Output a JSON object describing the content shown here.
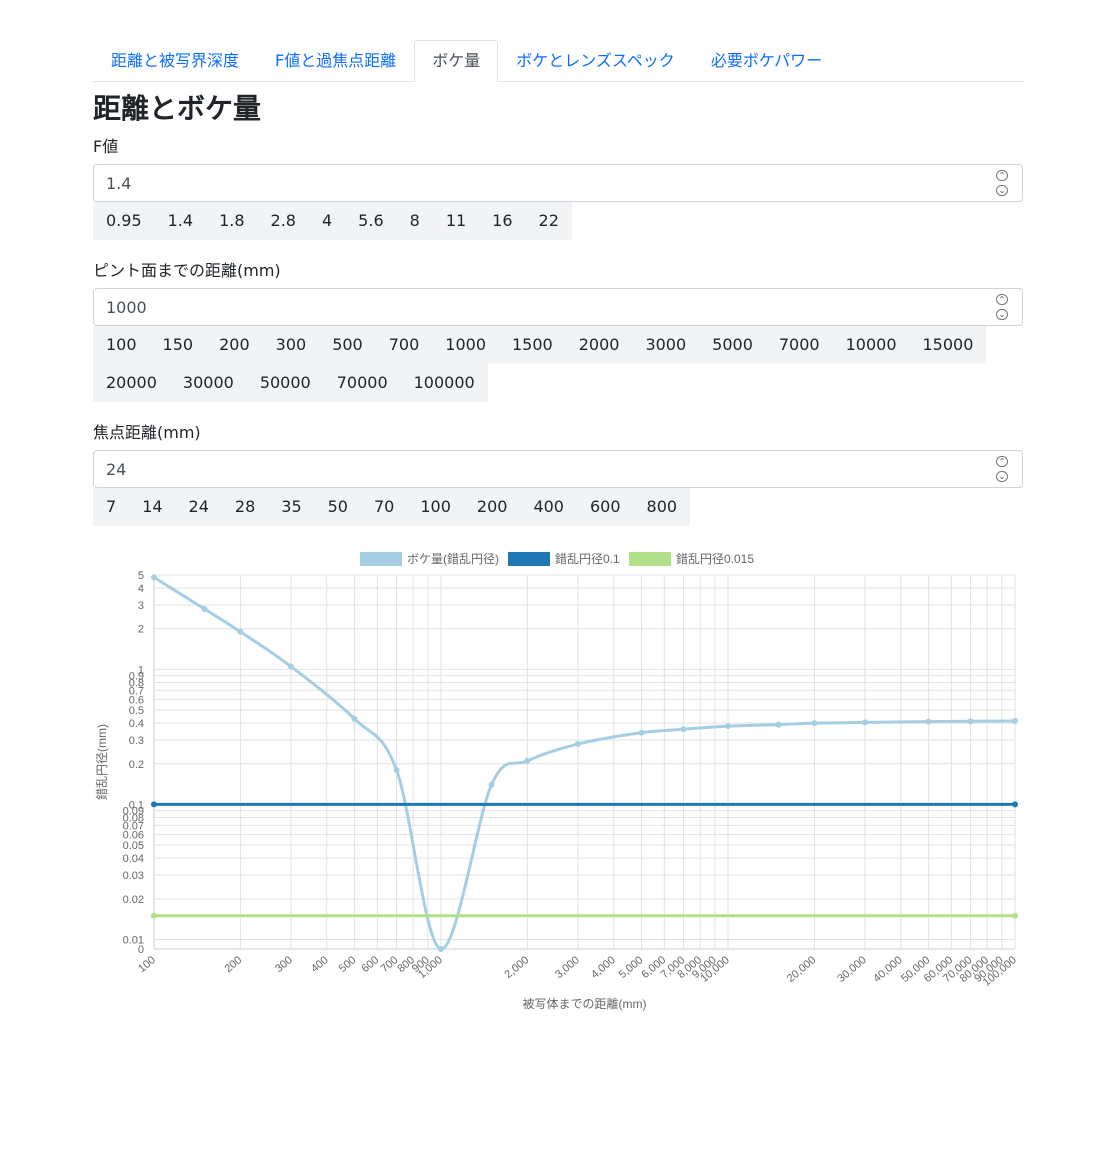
{
  "tabs": [
    {
      "label": "距離と被写界深度",
      "active": false
    },
    {
      "label": "F値と過焦点距離",
      "active": false
    },
    {
      "label": "ボケ量",
      "active": true
    },
    {
      "label": "ボケとレンズスペック",
      "active": false
    },
    {
      "label": "必要ボケパワー",
      "active": false
    }
  ],
  "page_title": "距離とボケ量",
  "fnumber": {
    "label": "F値",
    "value": "1.4",
    "presets": [
      "0.95",
      "1.4",
      "1.8",
      "2.8",
      "4",
      "5.6",
      "8",
      "11",
      "16",
      "22"
    ]
  },
  "distance": {
    "label": "ピント面までの距離(mm)",
    "value": "1000",
    "presets": [
      "100",
      "150",
      "200",
      "300",
      "500",
      "700",
      "1000",
      "1500",
      "2000",
      "3000",
      "5000",
      "7000",
      "10000",
      "15000",
      "20000",
      "30000",
      "50000",
      "70000",
      "100000"
    ]
  },
  "focal": {
    "label": "焦点距離(mm)",
    "value": "24",
    "presets": [
      "7",
      "14",
      "24",
      "28",
      "35",
      "50",
      "70",
      "100",
      "200",
      "400",
      "600",
      "800"
    ]
  },
  "chart_data": {
    "type": "line",
    "xlabel": "被写体までの距離(mm)",
    "ylabel": "錯乱円径(mm)",
    "x_scale": "log",
    "y_scale": "log",
    "xlim": [
      100,
      100000
    ],
    "ylim": [
      0,
      5
    ],
    "x_ticks": [
      "100",
      "200",
      "300",
      "400",
      "500",
      "600",
      "700",
      "800",
      "900",
      "1,000",
      "2,000",
      "3,000",
      "4,000",
      "5,000",
      "6,000",
      "7,000",
      "8,000",
      "9,000",
      "10,000",
      "20,000",
      "30,000",
      "40,000",
      "50,000",
      "60,000",
      "70,000",
      "80,000",
      "90,000",
      "100,000"
    ],
    "y_ticks": [
      "0",
      "0.01",
      "0.02",
      "0.03",
      "0.04",
      "0.05",
      "0.06",
      "0.07",
      "0.08",
      "0.09",
      "0.1",
      "0.2",
      "0.3",
      "0.4",
      "0.5",
      "0.6",
      "0.7",
      "0.8",
      "0.9",
      "1",
      "2",
      "3",
      "4",
      "5"
    ],
    "legend_position": "top",
    "series": [
      {
        "name": "ボケ量(錯乱円径)",
        "color": "#a6cee3",
        "x": [
          100,
          150,
          200,
          300,
          500,
          700,
          1000,
          1500,
          2000,
          3000,
          5000,
          7000,
          10000,
          15000,
          20000,
          30000,
          50000,
          70000,
          100000
        ],
        "y": [
          4.8,
          2.8,
          1.9,
          1.05,
          0.43,
          0.18,
          0,
          0.14,
          0.21,
          0.28,
          0.34,
          0.36,
          0.38,
          0.39,
          0.4,
          0.405,
          0.41,
          0.413,
          0.415
        ]
      },
      {
        "name": "錯乱円径0.1",
        "color": "#1f78b4",
        "x": [
          100,
          100000
        ],
        "y": [
          0.1,
          0.1
        ]
      },
      {
        "name": "錯乱円径0.015",
        "color": "#b2df8a",
        "x": [
          100,
          100000
        ],
        "y": [
          0.015,
          0.015
        ]
      }
    ]
  }
}
